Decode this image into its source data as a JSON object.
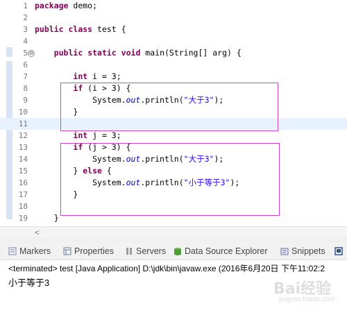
{
  "editor": {
    "lines": [
      {
        "num": "1",
        "tokens": [
          {
            "t": "package",
            "c": "kw"
          },
          {
            "t": " demo;",
            "c": ""
          }
        ]
      },
      {
        "num": "2",
        "tokens": []
      },
      {
        "num": "3",
        "tokens": [
          {
            "t": "public",
            "c": "kw"
          },
          {
            "t": " ",
            "c": ""
          },
          {
            "t": "class",
            "c": "kw"
          },
          {
            "t": " test {",
            "c": ""
          }
        ]
      },
      {
        "num": "4",
        "tokens": []
      },
      {
        "num": "5",
        "fold": true,
        "tokens": [
          {
            "t": "    ",
            "c": ""
          },
          {
            "t": "public",
            "c": "kw"
          },
          {
            "t": " ",
            "c": ""
          },
          {
            "t": "static",
            "c": "kw"
          },
          {
            "t": " ",
            "c": ""
          },
          {
            "t": "void",
            "c": "kw"
          },
          {
            "t": " main(String[] arg) {",
            "c": ""
          }
        ]
      },
      {
        "num": "6",
        "tokens": []
      },
      {
        "num": "7",
        "tokens": [
          {
            "t": "        ",
            "c": ""
          },
          {
            "t": "int",
            "c": "kw"
          },
          {
            "t": " i = 3;",
            "c": ""
          }
        ]
      },
      {
        "num": "8",
        "tokens": [
          {
            "t": "        ",
            "c": ""
          },
          {
            "t": "if",
            "c": "kw"
          },
          {
            "t": " (i > 3) {",
            "c": ""
          }
        ]
      },
      {
        "num": "9",
        "tokens": [
          {
            "t": "            System.",
            "c": ""
          },
          {
            "t": "out",
            "c": "fld"
          },
          {
            "t": ".println(",
            "c": ""
          },
          {
            "t": "\"大于3\"",
            "c": "str"
          },
          {
            "t": ");",
            "c": ""
          }
        ]
      },
      {
        "num": "10",
        "tokens": [
          {
            "t": "        }",
            "c": ""
          }
        ]
      },
      {
        "num": "11",
        "current": true,
        "tokens": []
      },
      {
        "num": "12",
        "tokens": [
          {
            "t": "        ",
            "c": ""
          },
          {
            "t": "int",
            "c": "kw"
          },
          {
            "t": " j = 3;",
            "c": ""
          }
        ]
      },
      {
        "num": "13",
        "tokens": [
          {
            "t": "        ",
            "c": ""
          },
          {
            "t": "if",
            "c": "kw"
          },
          {
            "t": " (j > 3) {",
            "c": ""
          }
        ]
      },
      {
        "num": "14",
        "tokens": [
          {
            "t": "            System.",
            "c": ""
          },
          {
            "t": "out",
            "c": "fld"
          },
          {
            "t": ".println(",
            "c": ""
          },
          {
            "t": "\"大于3\"",
            "c": "str"
          },
          {
            "t": ");",
            "c": ""
          }
        ]
      },
      {
        "num": "15",
        "tokens": [
          {
            "t": "        } ",
            "c": ""
          },
          {
            "t": "else",
            "c": "kw"
          },
          {
            "t": " {",
            "c": ""
          }
        ]
      },
      {
        "num": "16",
        "tokens": [
          {
            "t": "            System.",
            "c": ""
          },
          {
            "t": "out",
            "c": "fld"
          },
          {
            "t": ".println(",
            "c": ""
          },
          {
            "t": "\"小于等于3\"",
            "c": "str"
          },
          {
            "t": ");",
            "c": ""
          }
        ]
      },
      {
        "num": "17",
        "tokens": [
          {
            "t": "        }",
            "c": ""
          }
        ]
      },
      {
        "num": "18",
        "tokens": []
      },
      {
        "num": "19",
        "tokens": [
          {
            "t": "    }",
            "c": ""
          }
        ]
      }
    ],
    "fold_symbol": "⊖",
    "scroll_left_arrow": "<"
  },
  "views": {
    "tabs": [
      {
        "label": "Markers",
        "icon": "markers-icon",
        "color": "#7a8aa8"
      },
      {
        "label": "Properties",
        "icon": "properties-icon",
        "color": "#6f7f9a"
      },
      {
        "label": "Servers",
        "icon": "servers-icon",
        "color": "#8a8a8a"
      },
      {
        "label": "Data Source Explorer",
        "icon": "data-source-icon",
        "color": "#4f9d3a"
      },
      {
        "label": "Snippets",
        "icon": "snippets-icon",
        "color": "#6b6b9a"
      }
    ],
    "console_icon": "console-icon"
  },
  "console": {
    "header": "<terminated> test [Java Application] D:\\jdk\\bin\\javaw.exe (2016年6月20日 下午11:02:2",
    "output": "小于等于3"
  },
  "watermark": {
    "brand": "Bai经验",
    "url": "jingyan.baidu.com"
  },
  "colors": {
    "keyword": "#7f0055",
    "field": "#0000c0",
    "string": "#2a00ff",
    "highlight_box": "#d043c8",
    "current_line": "#e8f2fe"
  }
}
